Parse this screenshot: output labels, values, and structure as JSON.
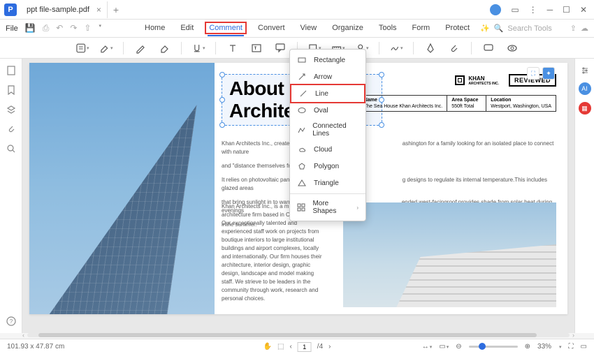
{
  "titlebar": {
    "tab_name": "ppt file-sample.pdf"
  },
  "menubar": {
    "file": "File",
    "tabs": [
      "Home",
      "Edit",
      "Comment",
      "Convert",
      "View",
      "Organize",
      "Tools",
      "Form",
      "Protect"
    ],
    "active_tab_index": 2,
    "search_placeholder": "Search Tools"
  },
  "shape_menu": {
    "items": [
      {
        "icon": "rectangle",
        "label": "Rectangle"
      },
      {
        "icon": "arrow",
        "label": "Arrow"
      },
      {
        "icon": "line",
        "label": "Line",
        "highlight": true
      },
      {
        "icon": "oval",
        "label": "Oval"
      },
      {
        "icon": "connected",
        "label": "Connected Lines"
      },
      {
        "icon": "cloud",
        "label": "Cloud"
      },
      {
        "icon": "polygon",
        "label": "Polygon"
      },
      {
        "icon": "triangle",
        "label": "Triangle"
      }
    ],
    "more": "More Shapes"
  },
  "document": {
    "title_line1": "About K",
    "title_line2": "Archite",
    "khan_label": "KHAN",
    "khan_sub": "ARCHITECTS INC.",
    "reviewed": "REVIEWED",
    "info": [
      {
        "h": "Name",
        "v": "The Sea House Khan Architects Inc."
      },
      {
        "h": "Area Space",
        "v": "550ft Total"
      },
      {
        "h": "Location",
        "v": "Westport, Washington, USA"
      }
    ],
    "p1": "Khan Architects Inc., created this",
    "p1b": "ashington for a family looking for an isolated place to connect with nature",
    "p1c": "and \"distance themselves from s",
    "p2": "It relies on photovoltaic panels fo",
    "p2b": "g designs to regulate its internal temperature.This includes glazed areas",
    "p3": "that bring sunlight in to warm the",
    "p3b": "ended west-facingroof provides shade from solar heat during evenings",
    "p4": "inthe summer.",
    "col": "Khan Architects Inc., is a mid-sized architecture firm based in California, USA. Our exceptionally talented and experienced staff work on projects from boutique interiors to large institutional buildings and airport complexes, locally and internationally. Our firm houses their architecture, interior design, graphic design, landscape and model making staff. We strieve to be leaders in the community through work, research and personal choices."
  },
  "statusbar": {
    "dimensions": "101.93 x 47.87 cm",
    "page_current": "1",
    "page_total": "4",
    "zoom": "33%"
  }
}
